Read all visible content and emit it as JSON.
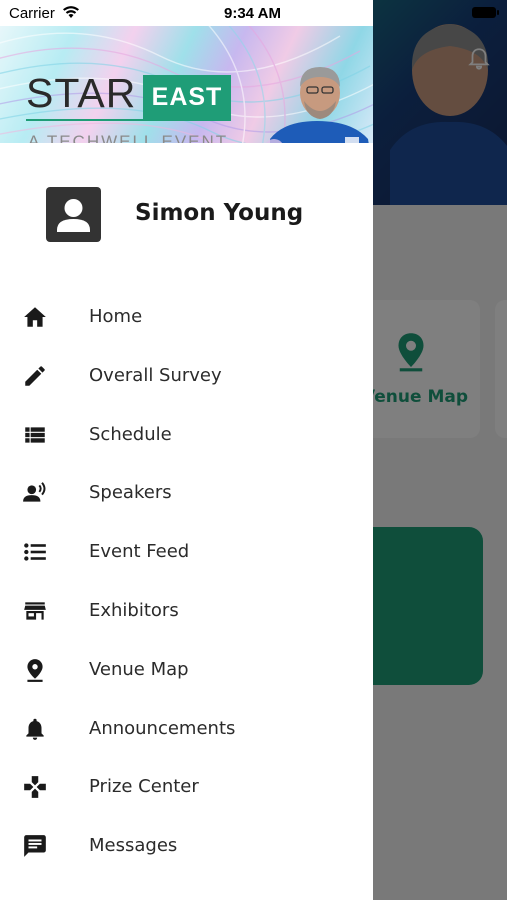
{
  "status_bar": {
    "carrier": "Carrier",
    "time": "9:34 AM"
  },
  "banner": {
    "brand_left": "STAR",
    "brand_right": "EAST",
    "tagline": "A TECHWELL EVENT"
  },
  "user": {
    "name": "Simon Young"
  },
  "menu": [
    {
      "label": "Home",
      "icon": "home-icon"
    },
    {
      "label": "Overall Survey",
      "icon": "pencil-icon"
    },
    {
      "label": "Schedule",
      "icon": "list-view-icon"
    },
    {
      "label": "Speakers",
      "icon": "speaker-person-icon"
    },
    {
      "label": "Event Feed",
      "icon": "bullet-list-icon"
    },
    {
      "label": "Exhibitors",
      "icon": "store-icon"
    },
    {
      "label": "Venue Map",
      "icon": "map-pin-icon"
    },
    {
      "label": "Announcements",
      "icon": "bell-icon"
    },
    {
      "label": "Prize Center",
      "icon": "gamepad-icon"
    },
    {
      "label": "Messages",
      "icon": "message-icon"
    }
  ],
  "background": {
    "card_label": "Venue Map"
  },
  "colors": {
    "brand_green": "#1f9d77",
    "text_dark": "#2b2b2b",
    "scrim": "rgba(0,0,0,0.5)"
  }
}
